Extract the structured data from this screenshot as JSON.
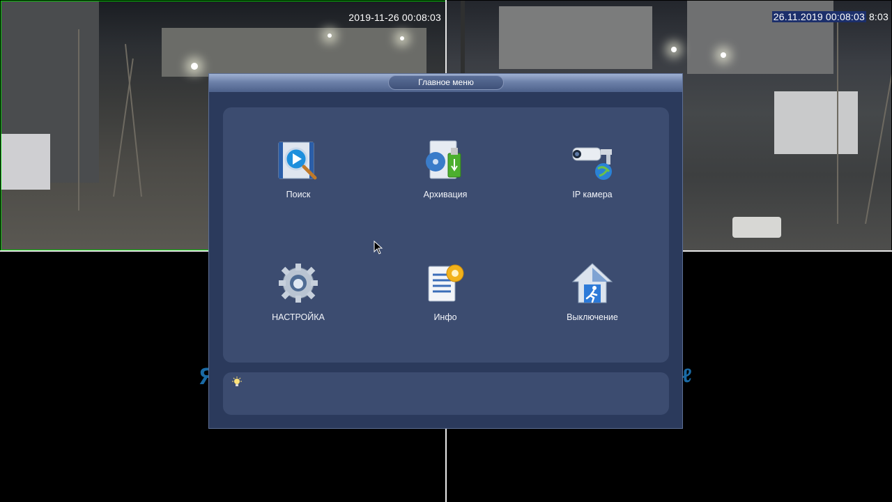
{
  "cameras": {
    "top_left": {
      "timestamp": "2019-11-26 00:08:03"
    },
    "top_right": {
      "timestamp": "26.11.2019 00:08:03",
      "timestamp_overlap": "8:03"
    }
  },
  "dialog": {
    "title": "Главное меню",
    "items": [
      {
        "label": "Поиск",
        "icon": "search-icon"
      },
      {
        "label": "Архивация",
        "icon": "archive-icon"
      },
      {
        "label": "IP камера",
        "icon": "ip-camera-icon"
      },
      {
        "label": "НАСТРОЙКА",
        "icon": "gear-icon"
      },
      {
        "label": "Инфо",
        "icon": "info-icon"
      },
      {
        "label": "Выключение",
        "icon": "shutdown-icon"
      }
    ],
    "tip_text": ""
  },
  "colors": {
    "dialog_bg": "#2b3a5c",
    "panel_bg": "#3c4c70",
    "active_border": "#00cc00"
  }
}
